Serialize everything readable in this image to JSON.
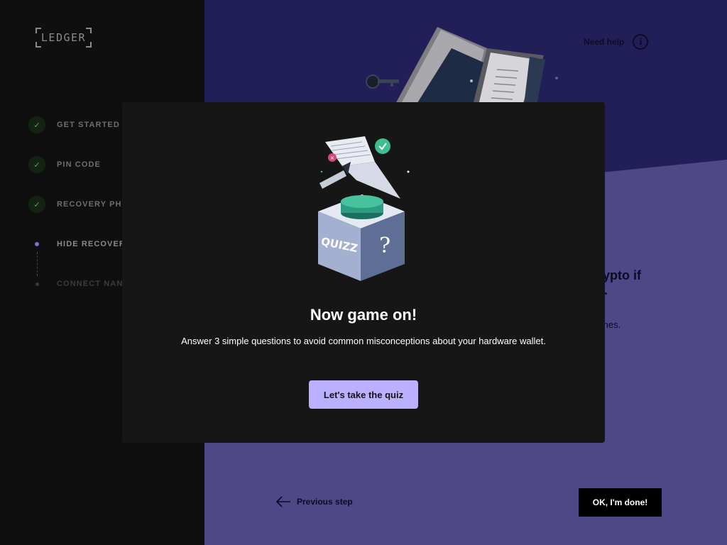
{
  "sidebar": {
    "logo": "LEDGER",
    "steps": [
      {
        "label": "GET STARTED",
        "state": "done"
      },
      {
        "label": "PIN CODE",
        "state": "done"
      },
      {
        "label": "RECOVERY PHR...",
        "state": "done"
      },
      {
        "label": "HIDE RECOVERY...",
        "state": "current"
      },
      {
        "label": "CONNECT NANO...",
        "state": "upcoming"
      }
    ]
  },
  "main": {
    "help_label": "Need help",
    "title_line1": "r crypto if",
    "title_line2": "nce.",
    "body_text": "rtphones.",
    "previous_label": "Previous step",
    "done_label": "OK, I'm done!"
  },
  "modal": {
    "title": "Now game on!",
    "description": "Answer 3 simple questions to avoid common misconceptions about your hardware wallet.",
    "button_label": "Let's take the quiz",
    "illustration_text": "QUIZZ",
    "illustration_symbol": "?"
  },
  "colors": {
    "sidebar_bg": "#0f0f0f",
    "main_top_bg": "#221e58",
    "main_bottom_bg": "#4e4887",
    "modal_bg": "#161616",
    "accent": "#bbb0ff",
    "success": "#4caf50"
  }
}
